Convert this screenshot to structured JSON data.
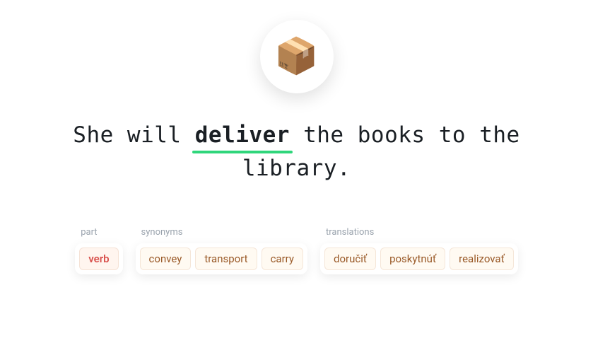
{
  "icon": "📦",
  "sentence": {
    "before": "She will ",
    "highlight": "deliver",
    "after": " the books to the library."
  },
  "groups": [
    {
      "label": "part",
      "style": "primary",
      "items": [
        "verb"
      ]
    },
    {
      "label": "synonyms",
      "style": "secondary",
      "items": [
        "convey",
        "transport",
        "carry"
      ]
    },
    {
      "label": "translations",
      "style": "secondary",
      "items": [
        "doručiť",
        "poskytnúť",
        "realizovať"
      ]
    }
  ]
}
